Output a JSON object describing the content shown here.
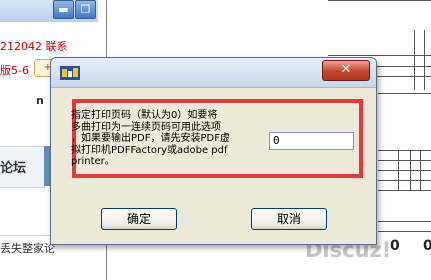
{
  "background_page": {
    "phone_text": "212042 联系",
    "version_text": "版5-6",
    "badge_text": "+6",
    "user_text": "n",
    "forum_tab": "论坛",
    "footer_text": "丢失整家论",
    "window_buttons": [
      "minimize-icon",
      "restore-icon"
    ]
  },
  "background_doc": {
    "zero_left": "0",
    "zero_right": "0",
    "watermark": "Discuz!"
  },
  "dialog": {
    "title": "",
    "close_label": "✕",
    "prompt": "指定打印页码（默认为0）如要将\n多曲打印为一连续页码可用此选项\n，如果要输出PDF，请先安装PDF虚\n拟打印机PDFFactory或adobe pdf\nprinter。",
    "page_number_value": "0",
    "ok_label": "确定",
    "cancel_label": "取消",
    "highlight_color": "#e23a3e"
  }
}
